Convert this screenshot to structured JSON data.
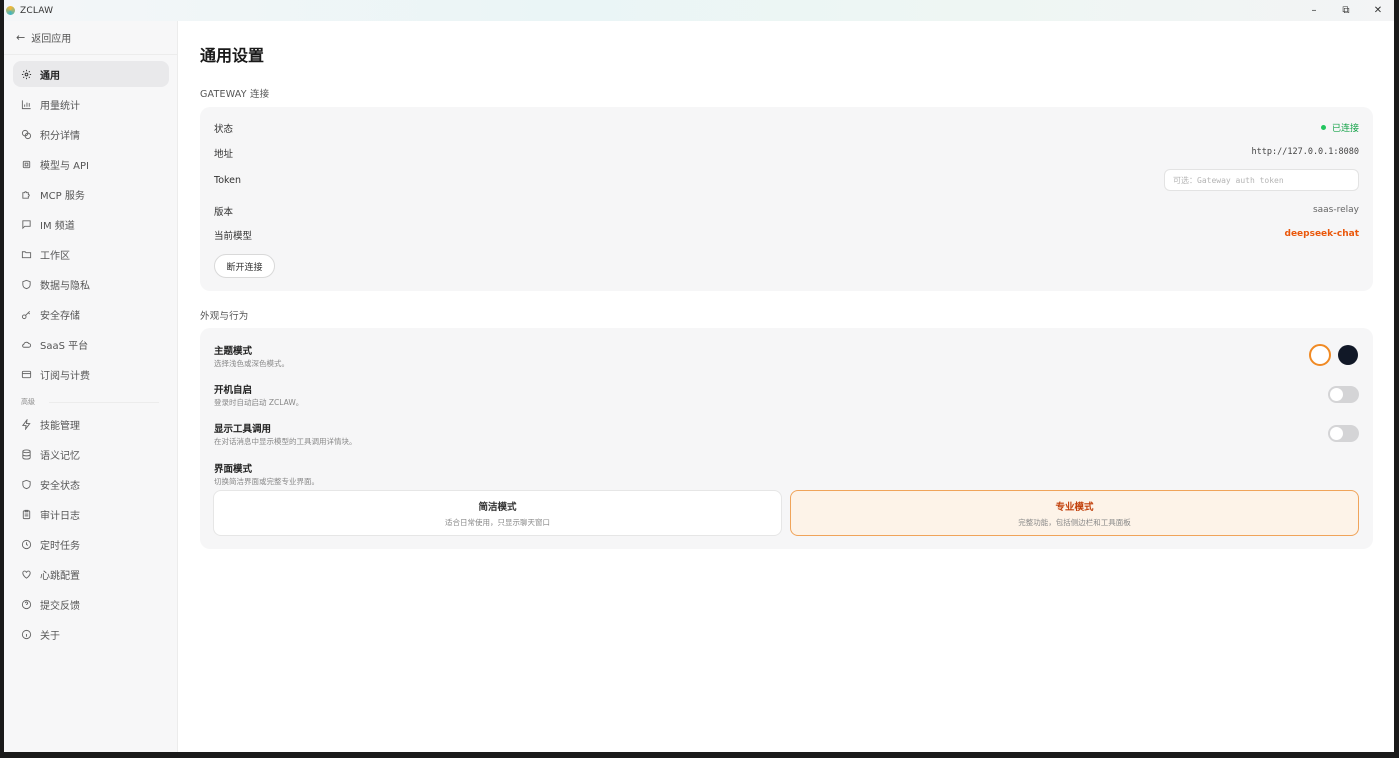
{
  "titlebar": {
    "app_name": "ZCLAW",
    "minimize": "–",
    "restore": "⧉",
    "close": "✕"
  },
  "sidebar": {
    "back_label": "返回应用",
    "items": [
      {
        "label": "通用",
        "icon": "gear-icon",
        "active": true
      },
      {
        "label": "用量统计",
        "icon": "bar-chart-icon"
      },
      {
        "label": "积分详情",
        "icon": "coins-icon"
      },
      {
        "label": "模型与 API",
        "icon": "cpu-icon"
      },
      {
        "label": "MCP 服务",
        "icon": "puzzle-icon"
      },
      {
        "label": "IM 频道",
        "icon": "message-icon"
      },
      {
        "label": "工作区",
        "icon": "folder-icon"
      },
      {
        "label": "数据与隐私",
        "icon": "shield-icon"
      },
      {
        "label": "安全存储",
        "icon": "key-icon"
      },
      {
        "label": "SaaS 平台",
        "icon": "cloud-icon"
      },
      {
        "label": "订阅与计费",
        "icon": "credit-card-icon"
      }
    ],
    "advanced_label": "高级",
    "advanced_items": [
      {
        "label": "技能管理",
        "icon": "zap-icon"
      },
      {
        "label": "语义记忆",
        "icon": "database-icon"
      },
      {
        "label": "安全状态",
        "icon": "shield-icon"
      },
      {
        "label": "审计日志",
        "icon": "clipboard-icon"
      },
      {
        "label": "定时任务",
        "icon": "clock-icon"
      },
      {
        "label": "心跳配置",
        "icon": "heart-icon"
      },
      {
        "label": "提交反馈",
        "icon": "help-circle-icon"
      },
      {
        "label": "关于",
        "icon": "info-icon"
      }
    ]
  },
  "main": {
    "title": "通用设置",
    "gateway": {
      "section_title": "GATEWAY 连接",
      "status_label": "状态",
      "status_value": "已连接",
      "address_label": "地址",
      "address_value": "http://127.0.0.1:8080",
      "token_label": "Token",
      "token_placeholder": "可选：Gateway auth token",
      "version_label": "版本",
      "version_value": "saas-relay",
      "model_label": "当前模型",
      "model_value": "deepseek-chat",
      "disconnect_label": "断开连接"
    },
    "appearance": {
      "section_title": "外观与行为",
      "theme_title": "主题模式",
      "theme_desc": "选择浅色或深色模式。",
      "autostart_title": "开机自启",
      "autostart_desc": "登录时自动启动 ZCLAW。",
      "autostart_on": false,
      "show_tools_title": "显示工具调用",
      "show_tools_desc": "在对话消息中显示模型的工具调用详情块。",
      "show_tools_on": false,
      "ui_mode_title": "界面模式",
      "ui_mode_desc": "切换简洁界面或完整专业界面。",
      "simple_mode_title": "简洁模式",
      "simple_mode_desc": "适合日常使用，只显示聊天窗口",
      "pro_mode_title": "专业模式",
      "pro_mode_desc": "完整功能，包括侧边栏和工具面板",
      "selected_mode": "专业模式"
    }
  },
  "colors": {
    "accent": "#ea580c",
    "connected": "#22c55e",
    "selected_border": "#f0a45a",
    "selected_bg": "#fdf3e8"
  }
}
